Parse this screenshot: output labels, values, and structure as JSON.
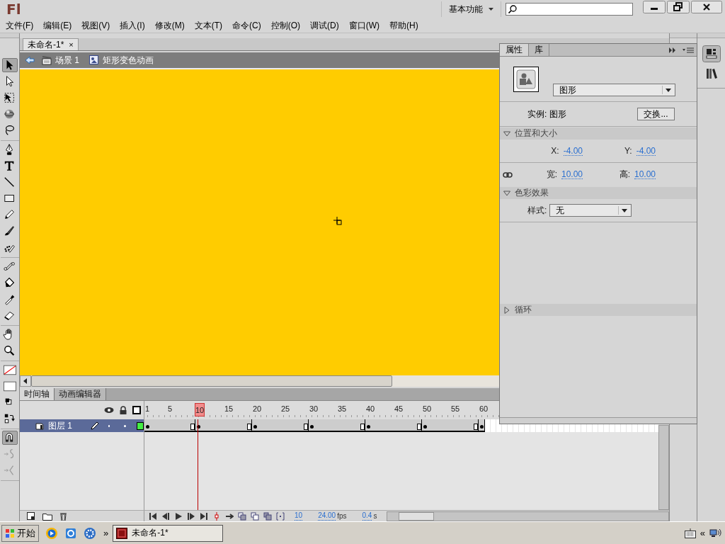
{
  "app": {
    "logo": "Fl",
    "workspace": "基本功能"
  },
  "menu": [
    "文件(F)",
    "编辑(E)",
    "视图(V)",
    "插入(I)",
    "修改(M)",
    "文本(T)",
    "命令(C)",
    "控制(O)",
    "调试(D)",
    "窗口(W)",
    "帮助(H)"
  ],
  "document_tabs": [
    {
      "label": "未命名-1*",
      "selected": true,
      "close": "×"
    }
  ],
  "breadcrumb": [
    {
      "kind": "scene",
      "label": "场景 1"
    },
    {
      "kind": "symbol",
      "label": "矩形变色动画"
    }
  ],
  "tool_groups": [
    [
      {
        "kind": "selection",
        "selected": true
      },
      {
        "kind": "subselection",
        "selected": false
      },
      {
        "kind": "free-transform",
        "selected": false
      },
      {
        "kind": "rotate-3d",
        "selected": false
      },
      {
        "kind": "lasso",
        "selected": false
      }
    ],
    [
      {
        "kind": "pen",
        "selected": false
      },
      {
        "kind": "text",
        "selected": false
      },
      {
        "kind": "line",
        "selected": false
      },
      {
        "kind": "rectangle",
        "selected": false
      },
      {
        "kind": "pencil",
        "selected": false
      },
      {
        "kind": "brush",
        "selected": false
      },
      {
        "kind": "deco",
        "selected": false
      }
    ],
    [
      {
        "kind": "bone",
        "selected": false
      },
      {
        "kind": "bucket",
        "selected": false
      },
      {
        "kind": "eyedropper",
        "selected": false
      },
      {
        "kind": "eraser",
        "selected": false
      }
    ],
    [
      {
        "kind": "hand",
        "selected": false
      },
      {
        "kind": "zoom",
        "selected": false
      }
    ],
    [
      {
        "kind": "stroke-color",
        "selected": false
      },
      {
        "kind": "fill-color",
        "selected": false
      },
      {
        "kind": "default-colors",
        "selected": false
      },
      {
        "kind": "swap-colors",
        "selected": false
      }
    ],
    [
      {
        "kind": "snap",
        "selected": true
      },
      {
        "kind": "smooth",
        "selected": false
      },
      {
        "kind": "straighten",
        "selected": false
      }
    ]
  ],
  "timeline": {
    "tabs": [
      {
        "label": "时间轴",
        "selected": true
      },
      {
        "label": "动画编辑器",
        "selected": false
      }
    ],
    "ruler": [
      {
        "label": "1",
        "current": false
      },
      {
        "label": "5",
        "current": false
      },
      {
        "label": "10",
        "current": true
      },
      {
        "label": "15",
        "current": false
      },
      {
        "label": "20",
        "current": false
      },
      {
        "label": "25",
        "current": false
      },
      {
        "label": "30",
        "current": false
      },
      {
        "label": "35",
        "current": false
      },
      {
        "label": "40",
        "current": false
      },
      {
        "label": "45",
        "current": false
      },
      {
        "label": "50",
        "current": false
      },
      {
        "label": "55",
        "current": false
      },
      {
        "label": "60",
        "current": false
      }
    ],
    "layers": [
      {
        "name": "图层 1",
        "selected": true,
        "color": "#44ee44"
      }
    ],
    "status": {
      "current_frame": "10",
      "frame_rate": "24.00",
      "fps_unit": "fps",
      "elapsed": "0.4",
      "seconds_unit": "s"
    }
  },
  "properties": {
    "tabs": [
      {
        "label": "属性",
        "selected": true
      },
      {
        "label": "库",
        "selected": false
      }
    ],
    "symbol_type": "图形",
    "instance_label": "实例:",
    "instance_value": "图形",
    "swap_button": "交换...",
    "sections": [
      {
        "kind": "position",
        "title": "位置和大小",
        "expanded": true,
        "rows": [
          [
            {
              "label": "X:",
              "value": "-4.00"
            },
            {
              "label": "Y:",
              "value": "-4.00"
            }
          ],
          [
            {
              "label": "宽:",
              "value": "10.00"
            },
            {
              "label": "高:",
              "value": "10.00"
            }
          ]
        ]
      },
      {
        "kind": "color",
        "title": "色彩效果",
        "expanded": true,
        "style_label": "样式:",
        "style_value": "无"
      },
      {
        "kind": "loop",
        "title": "循环",
        "expanded": false
      }
    ]
  },
  "taskbar": {
    "start": "开始",
    "chevron": "»",
    "tasks": [
      {
        "label": "未命名-1*",
        "selected": true
      }
    ],
    "tray_chevron": "«"
  }
}
